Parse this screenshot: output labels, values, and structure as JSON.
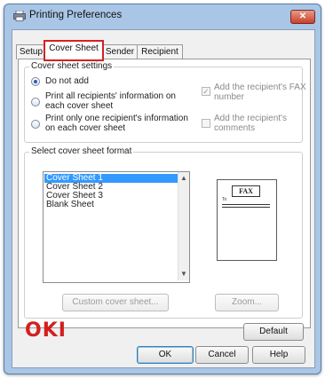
{
  "window": {
    "title": "Printing Preferences",
    "icon": "printer-icon",
    "close_glyph": "✕"
  },
  "tabs": [
    {
      "label": "Setup",
      "active": false
    },
    {
      "label": "Cover Sheet",
      "active": true
    },
    {
      "label": "Sender",
      "active": false
    },
    {
      "label": "Recipient",
      "active": false
    }
  ],
  "cover_settings": {
    "group_label": "Cover sheet settings",
    "options": [
      {
        "label_lines": [
          "Do not add"
        ],
        "checked": true
      },
      {
        "label_lines": [
          "Print all recipients' information on",
          "each cover sheet"
        ],
        "checked": false
      },
      {
        "label_lines": [
          "Print only one recipient's information",
          "on each cover sheet"
        ],
        "checked": false
      }
    ],
    "checkboxes": [
      {
        "label_lines": [
          "Add the recipient's FAX",
          "number"
        ],
        "checked": true,
        "enabled": false
      },
      {
        "label_lines": [
          "Add the recipient's",
          "comments"
        ],
        "checked": false,
        "enabled": false
      }
    ]
  },
  "format": {
    "group_label": "Select cover sheet format",
    "items": [
      "Cover Sheet 1",
      "Cover Sheet 2",
      "Cover Sheet 3",
      "Blank Sheet"
    ],
    "selected_index": 0,
    "preview_header": "FAX",
    "preview_label": "To"
  },
  "buttons": {
    "custom": "Custom cover sheet...",
    "zoom": "Zoom...",
    "default": "Default",
    "ok": "OK",
    "cancel": "Cancel",
    "help": "Help"
  },
  "brand": {
    "logo_text": "OKI",
    "color": "#d41f1f"
  },
  "colors": {
    "tab_highlight": "#d32222",
    "selection": "#3399ff",
    "titlebar": "#a9c6e6"
  }
}
